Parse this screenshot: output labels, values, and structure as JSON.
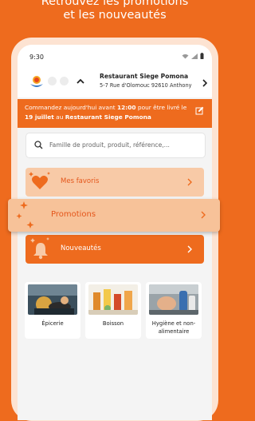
{
  "headline": {
    "line1": "Retrouvez les promotions",
    "line2": "et les nouveautés"
  },
  "status_bar": {
    "time": "9:30"
  },
  "header": {
    "restaurant_name": "Restaurant Siege Pomona",
    "restaurant_address": "5-7 Rue d'Olomouc 92610 Anthony"
  },
  "banner": {
    "text_before": "Commandez aujourd'hui avant ",
    "deadline": "12:00",
    "text_middle": " pour être livré le ",
    "delivery_date": "19 juillet",
    "text_after": " au ",
    "restaurant": "Restaurant Siege Pomona"
  },
  "search": {
    "placeholder": "Famille de produit, produit, référence,..."
  },
  "menu": {
    "favorites_label": "Mes favoris",
    "promotions_label": "Promotions",
    "news_label": "Nouveautés"
  },
  "categories": [
    {
      "label": "Épicerie",
      "icon": "grocery-photo"
    },
    {
      "label": "Boisson",
      "icon": "drinks-photo"
    },
    {
      "label": "Hygiène et non-alimentaire",
      "icon": "hygiene-photo"
    }
  ],
  "colors": {
    "accent": "#ee6b1e",
    "light_accent": "#f8caa7",
    "background": "#f4f4f4"
  }
}
